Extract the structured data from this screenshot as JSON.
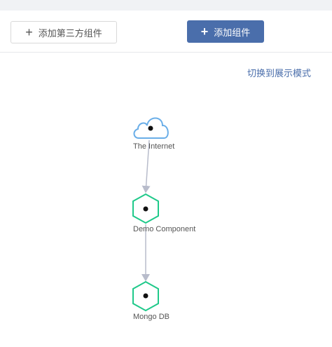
{
  "toolbar": {
    "third_party_button": {
      "icon": "plus-icon",
      "label": "添加第三方组件"
    },
    "add_component_button": {
      "icon": "plus-icon",
      "label": "添加组件"
    }
  },
  "switch_mode_link": "切换到展示模式",
  "colors": {
    "primary": "#4a6eab",
    "cloud_stroke": "#6aaee8",
    "component_stroke": "#1fc98a",
    "edge": "#b8bccb"
  },
  "graph": {
    "nodes": [
      {
        "id": "internet",
        "shape": "cloud-icon",
        "label": "The Internet"
      },
      {
        "id": "demo",
        "shape": "hexagon-icon",
        "label": "Demo Component"
      },
      {
        "id": "mongo",
        "shape": "hexagon-icon",
        "label": "Mongo DB"
      }
    ],
    "edges": [
      {
        "from": "internet",
        "to": "demo"
      },
      {
        "from": "demo",
        "to": "mongo"
      }
    ]
  }
}
